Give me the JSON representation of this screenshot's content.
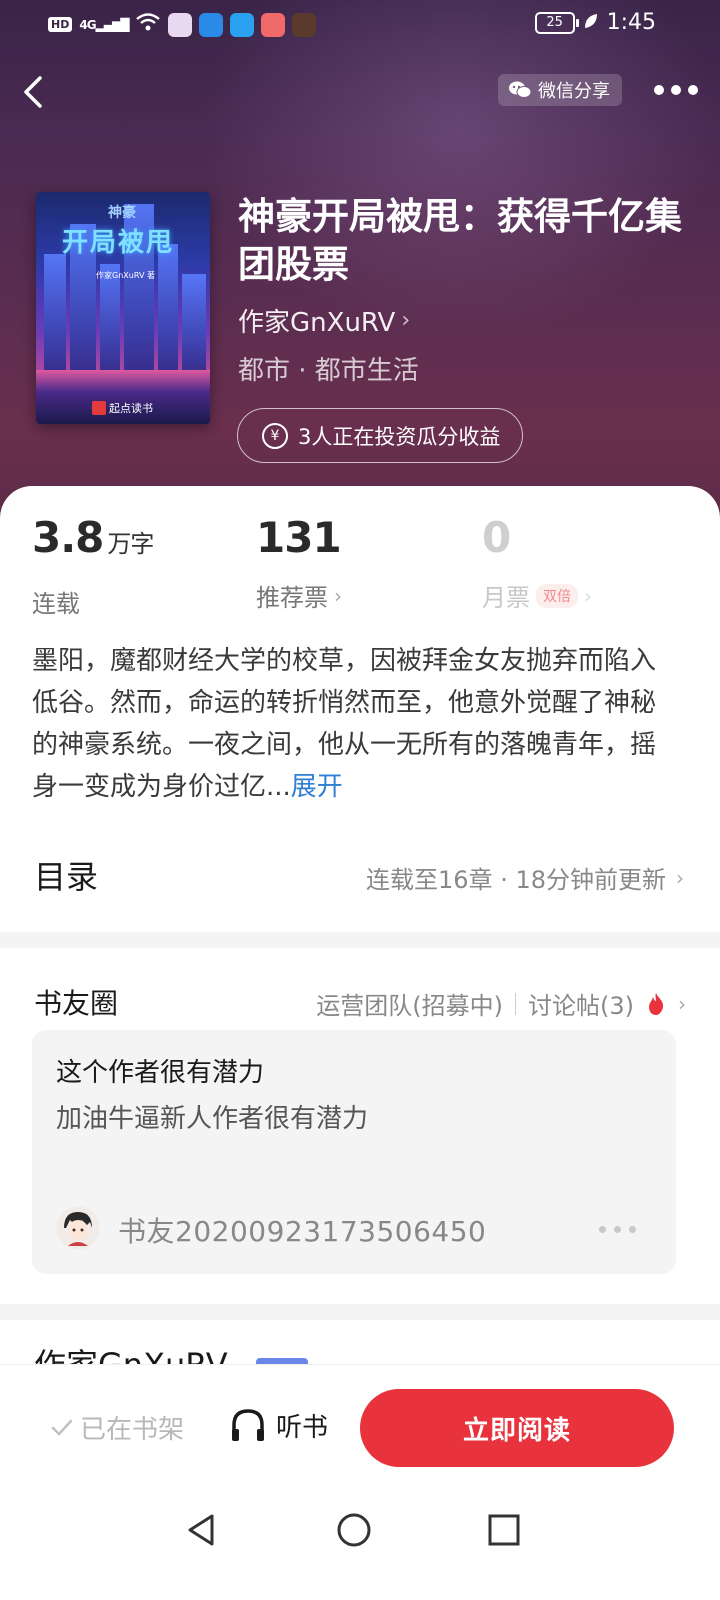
{
  "status_bar": {
    "left_badge": "HD",
    "signal": "4G",
    "battery": "25",
    "time": "1:45"
  },
  "nav": {
    "share_label": "微信分享"
  },
  "book": {
    "cover": {
      "title_small": "神豪",
      "title_big": "开局被甩",
      "author_line": "作家GnXuRV 著",
      "publisher": "起点读书"
    },
    "title": "神豪开局被甩：获得千亿集团股票",
    "author": "作家GnXuRV",
    "genre": "都市 · 都市生活",
    "invest_label": "3人正在投资瓜分收益"
  },
  "stats": {
    "words": {
      "value": "3.8",
      "unit": "万字",
      "label": "连载"
    },
    "recommend": {
      "value": "131",
      "label": "推荐票"
    },
    "monthly": {
      "value": "0",
      "label": "月票",
      "badge": "双倍"
    }
  },
  "intro": {
    "text": "墨阳，魔都财经大学的校草，因被拜金女友抛弃而陷入低谷。然而，命运的转折悄然而至，他意外觉醒了神秘的神豪系统。一夜之间，他从一无所有的落魄青年，摇身一变成为身价过亿...",
    "expand_label": "展开"
  },
  "toc": {
    "title": "目录",
    "info": "连载至16章 · 18分钟前更新"
  },
  "circle": {
    "title": "书友圈",
    "team_link": "运营团队(招募中)",
    "threads_link": "讨论帖(3)",
    "post": {
      "title": "这个作者很有潜力",
      "body": "加油牛逼新人作者很有潜力",
      "user": "书友20200923173506450"
    }
  },
  "author_section": {
    "title_partial": "作家GnXuRV"
  },
  "bottom_bar": {
    "shelf_label": "已在书架",
    "listen_label": "听书",
    "read_label": "立即阅读"
  },
  "colors": {
    "accent_red": "#e8323c",
    "link_blue": "#2f7fd6",
    "hero_bg": "#4a2a52"
  }
}
